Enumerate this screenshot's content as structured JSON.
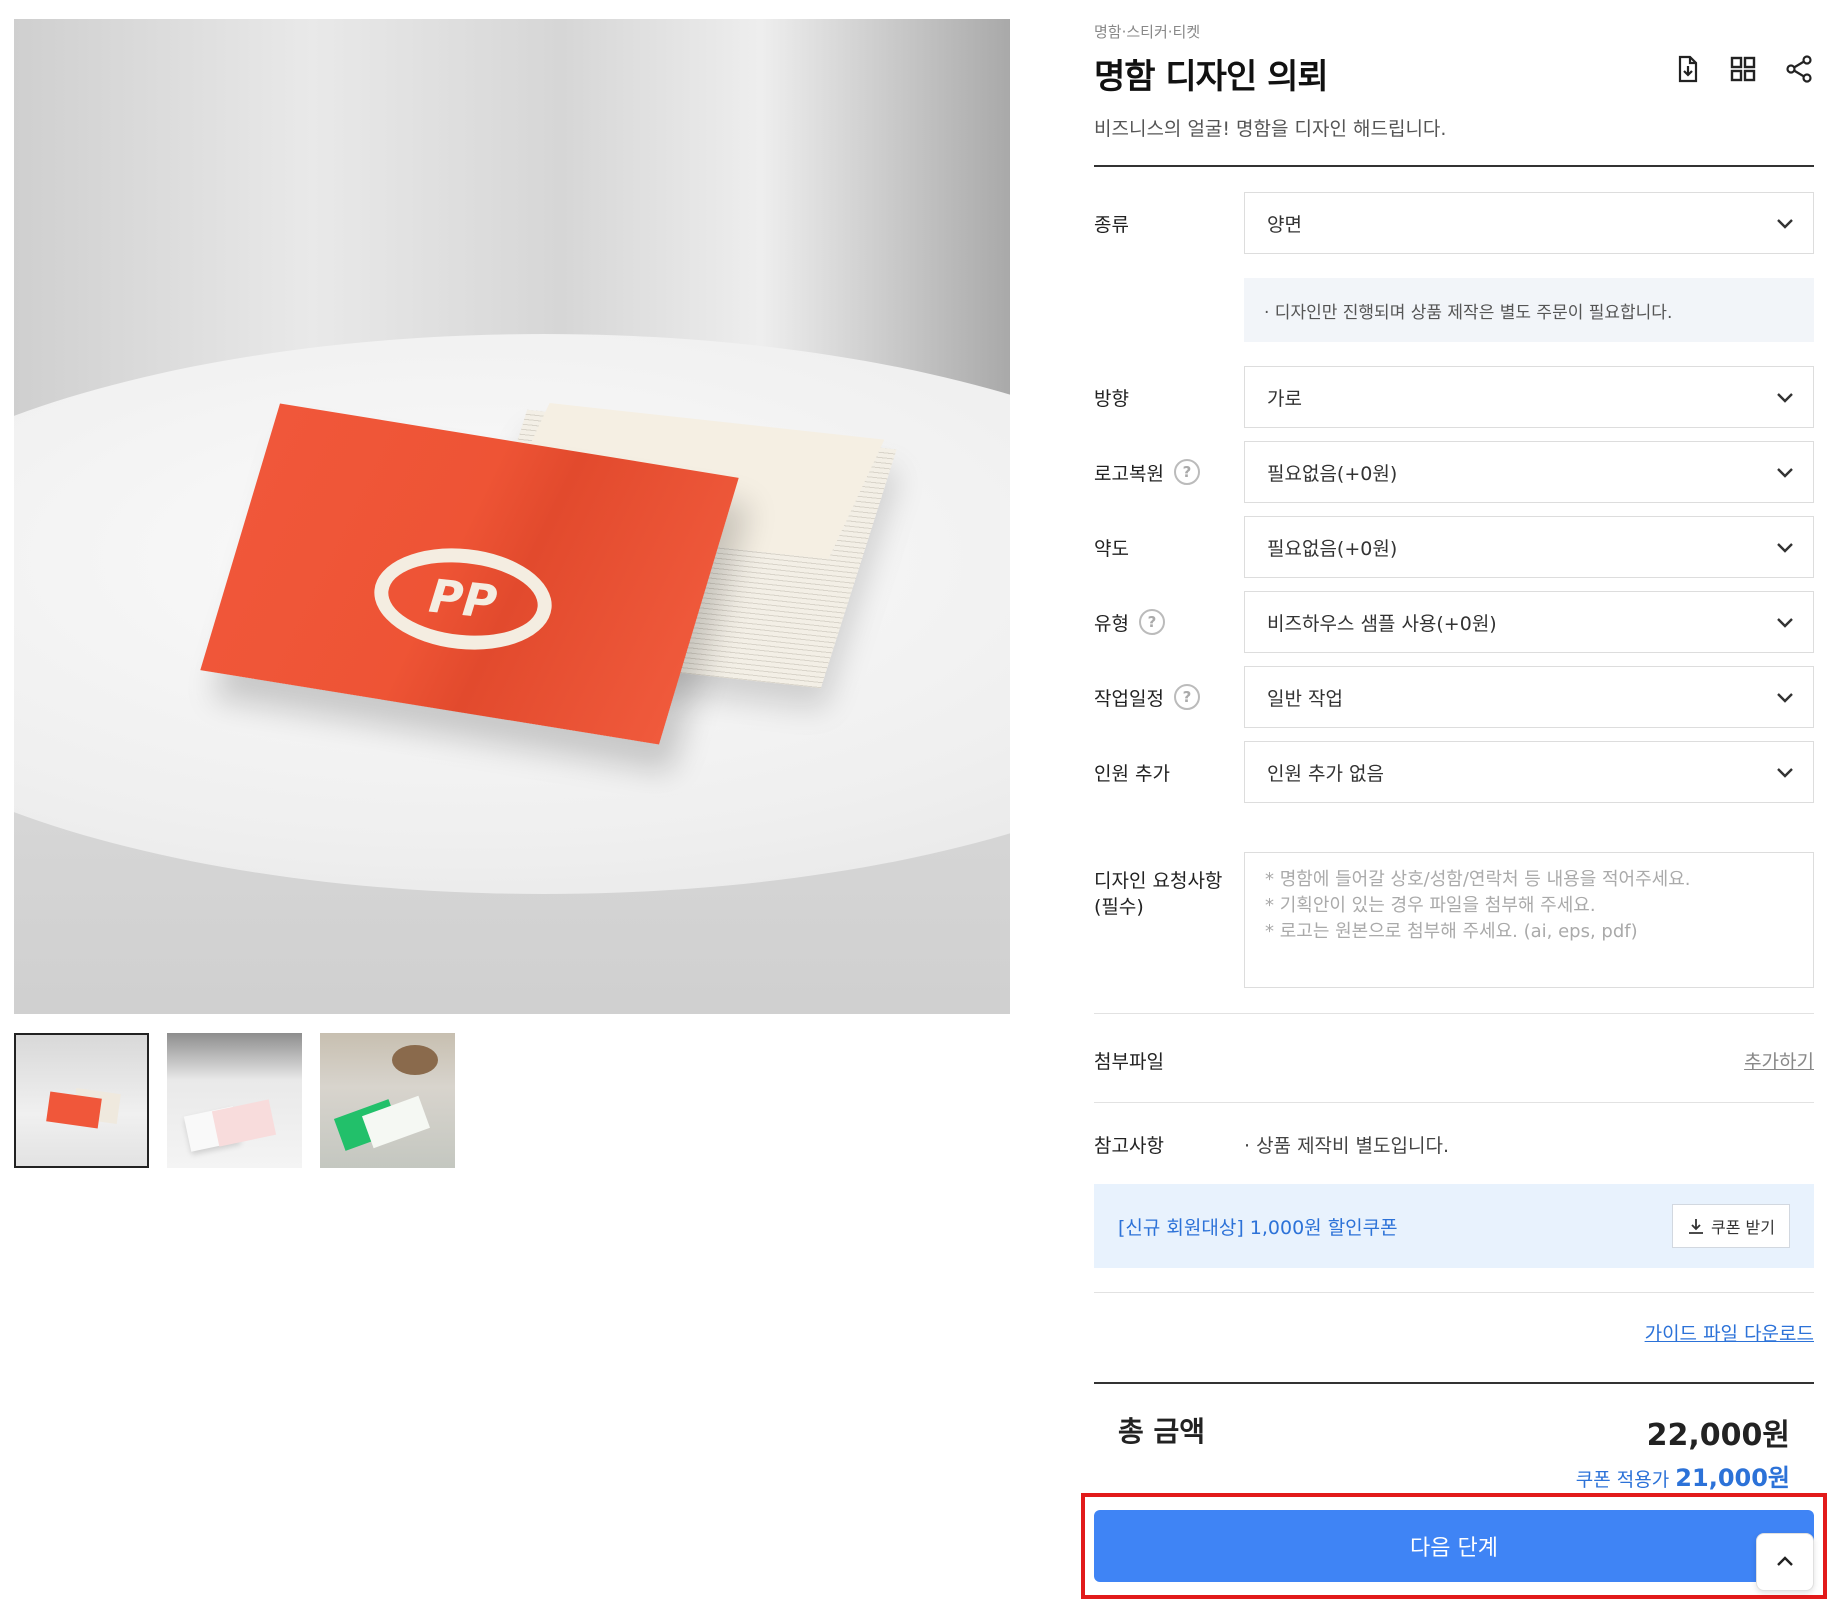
{
  "product": {
    "category": "명함·스티커·티켓",
    "title": "명함 디자인 의뢰",
    "subtitle": "비즈니스의 얼굴! 명함을 디자인 해드립니다.",
    "image_logo_text": "PP",
    "icons": [
      "download-icon",
      "grid-icon",
      "share-icon"
    ]
  },
  "options": {
    "type": {
      "label": "종류",
      "value": "양면"
    },
    "type_note": "· 디자인만 진행되며 상품 제작은 별도 주문이 필요합니다.",
    "orientation": {
      "label": "방향",
      "value": "가로"
    },
    "logo_restore": {
      "label": "로고복원",
      "value": "필요없음(+0원)"
    },
    "map": {
      "label": "약도",
      "value": "필요없음(+0원)"
    },
    "style": {
      "label": "유형",
      "value": "비즈하우스 샘플 사용(+0원)"
    },
    "schedule": {
      "label": "작업일정",
      "value": "일반 작업"
    },
    "people": {
      "label": "인원 추가",
      "value": "인원 추가 없음"
    }
  },
  "request": {
    "label_line1": "디자인 요청사항",
    "label_line2": "(필수)",
    "placeholder_line1": "* 명함에 들어갈 상호/성함/연락처 등 내용을 적어주세요.",
    "placeholder_line2": "* 기획안이 있는 경우 파일을 첨부해 주세요.",
    "placeholder_line3": "* 로고는 원본으로 첨부해 주세요. (ai, eps, pdf)"
  },
  "attachment": {
    "label": "첨부파일",
    "action": "추가하기"
  },
  "reference": {
    "label": "참고사항",
    "text": "· 상품 제작비 별도입니다."
  },
  "coupon": {
    "text": "[신규 회원대상] 1,000원 할인쿠폰",
    "button": "쿠폰 받기"
  },
  "guide_link": "가이드 파일 다운로드",
  "total": {
    "label": "총 금액",
    "price": "22,000원",
    "coupon_label": "쿠폰 적용가",
    "coupon_price": "21,000원"
  },
  "next_button": "다음 단계",
  "colors": {
    "accent": "#3f84f5",
    "link": "#2c72d8",
    "highlight": "#e21a1a",
    "coupon_bg": "#e8f2fd"
  }
}
